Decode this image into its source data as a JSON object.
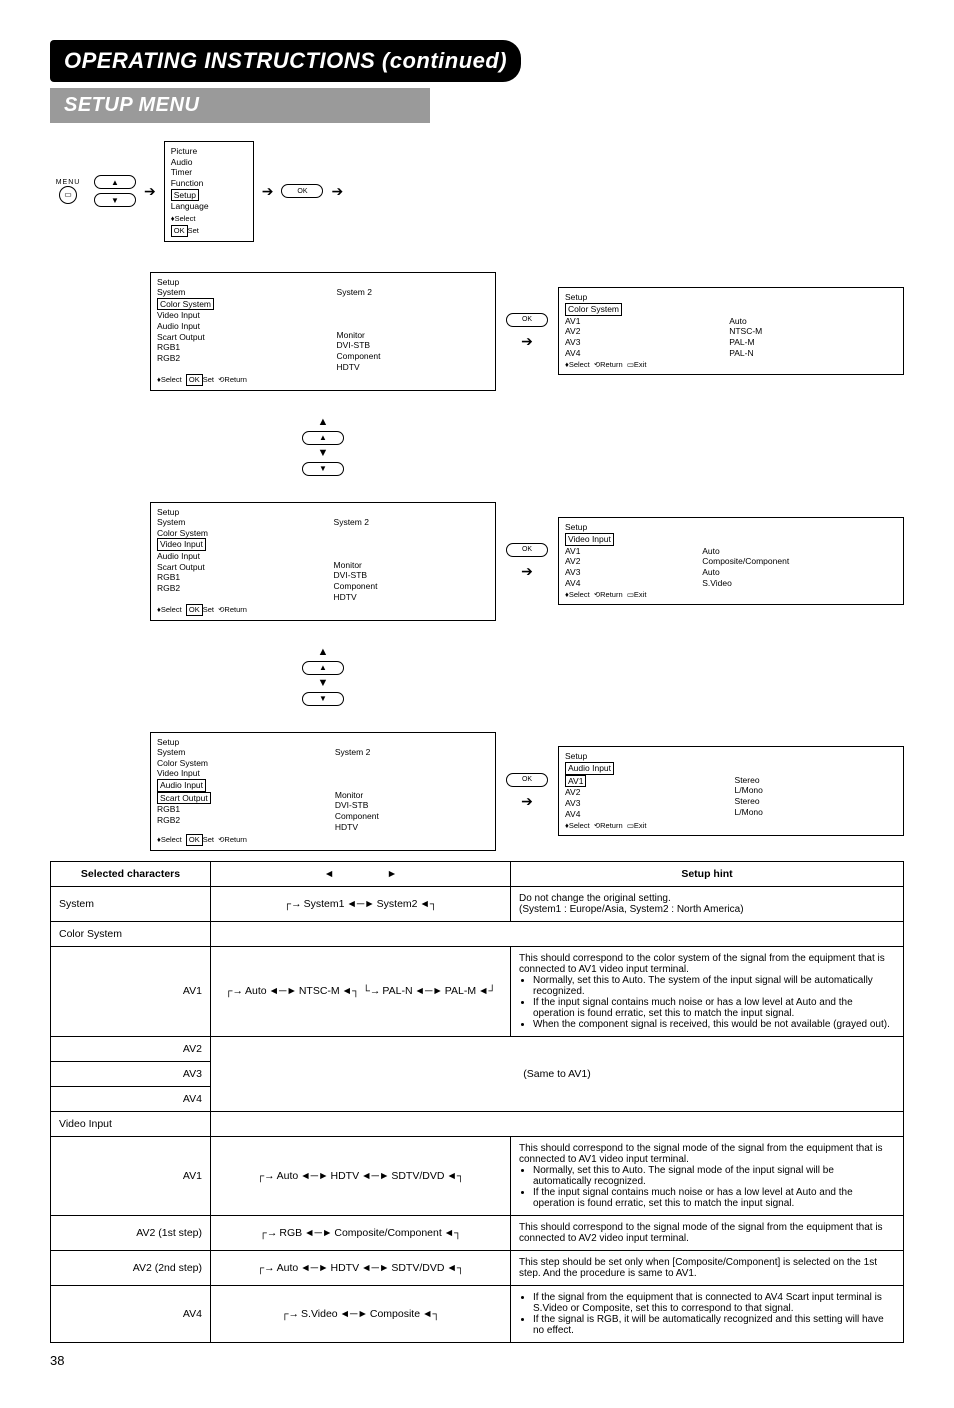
{
  "page_number": "38",
  "titles": {
    "main": "OPERATING INSTRUCTIONS (continued)",
    "sub": "SETUP MENU"
  },
  "menu_btn": {
    "label": "MENU"
  },
  "ok_btn": {
    "label": "OK"
  },
  "osd_main_menu": {
    "items": [
      "Picture",
      "Audio",
      "Timer",
      "Function",
      "Setup",
      "Language"
    ],
    "highlight": "Setup",
    "footer_select": "Select",
    "footer_set": "Set",
    "footer_ok": "OK"
  },
  "osd_setup_list": {
    "title": "Setup",
    "items": [
      "System",
      "Color System",
      "Video Input",
      "Audio Input",
      "Scart Output",
      "RGB1",
      "RGB2"
    ],
    "right_col_header": "System 2",
    "right_values": [
      "Monitor",
      "DVI-STB",
      "Component",
      "HDTV"
    ],
    "footer": {
      "select": "Select",
      "set": "Set",
      "ok": "OK",
      "return": "Return"
    }
  },
  "osd_color_system": {
    "title": "Setup",
    "hl": "Color System",
    "rows": [
      {
        "k": "AV1",
        "v": "Auto"
      },
      {
        "k": "AV2",
        "v": "NTSC-M"
      },
      {
        "k": "AV3",
        "v": "PAL-M"
      },
      {
        "k": "AV4",
        "v": "PAL-N"
      }
    ],
    "footer": {
      "select": "Select",
      "return": "Return",
      "exit": "Exit"
    }
  },
  "osd_video_input": {
    "title": "Setup",
    "hl": "Video Input",
    "rows": [
      {
        "k": "AV1",
        "v": "Auto"
      },
      {
        "k": "AV2",
        "v": "Composite/Component"
      },
      {
        "k": "AV3",
        "v": "Auto"
      },
      {
        "k": "AV4",
        "v": "S.Video"
      }
    ],
    "footer": {
      "select": "Select",
      "return": "Return",
      "exit": "Exit"
    }
  },
  "osd_audio_input": {
    "title": "Setup",
    "hl": "Audio Input",
    "rows": [
      {
        "k": "AV1",
        "v": "Stereo"
      },
      {
        "k": "AV2",
        "v": "L/Mono"
      },
      {
        "k": "AV3",
        "v": "Stereo"
      },
      {
        "k": "AV4",
        "v": "L/Mono"
      }
    ],
    "footer": {
      "select": "Select",
      "return": "Return",
      "exit": "Exit"
    }
  },
  "osd_setup_highlights": {
    "color_system": "Color System",
    "video_input": "Video Input",
    "audio_input": "Audio Input",
    "scart_output": "Scart Output"
  },
  "table": {
    "headers": {
      "selected": "Selected characters",
      "left_arrow": "◄",
      "right_arrow": "►",
      "hint": "Setup hint"
    },
    "rows": {
      "system": {
        "label": "System",
        "cycle": [
          "System1",
          "System2"
        ],
        "hint_lines": [
          "Do not change the original setting.",
          "(System1 : Europe/Asia, System2 : North America)"
        ]
      },
      "color_system": {
        "label": "Color System"
      },
      "cs_av1": {
        "label": "AV1",
        "cycle_top": [
          "Auto",
          "NTSC-M"
        ],
        "cycle_bot": [
          "PAL-N",
          "PAL-M"
        ],
        "hints": [
          "This should correspond to the color system of the signal from the equipment that is connected to AV1 video input terminal.",
          "Normally, set this to Auto. The system of the input signal will be automatically recognized.",
          "If the input signal contains much noise or has a low level at Auto and the operation is found erratic, set this to match the input signal.",
          "When the component signal is received, this would be not available (grayed out)."
        ]
      },
      "cs_av2": {
        "label": "AV2"
      },
      "cs_av3": {
        "label": "AV3",
        "same": "(Same to AV1)"
      },
      "cs_av4": {
        "label": "AV4"
      },
      "video_input": {
        "label": "Video Input"
      },
      "vi_av1": {
        "label": "AV1",
        "cycle": [
          "Auto",
          "HDTV",
          "SDTV/DVD"
        ],
        "hints": [
          "This should correspond to the signal mode of the signal from the equipment that is connected to AV1 video input terminal.",
          "Normally, set this to Auto. The signal mode of the input signal will be automatically recognized.",
          "If the input signal contains much noise or has a low level at Auto and the operation is found erratic, set this to match the input signal."
        ]
      },
      "vi_av2_1": {
        "label": "AV2 (1st step)",
        "cycle": [
          "RGB",
          "Composite/Component"
        ],
        "hint": "This should correspond to the signal mode of the signal from the equipment that is connected to AV2 video input terminal."
      },
      "vi_av2_2": {
        "label": "AV2 (2nd step)",
        "cycle": [
          "Auto",
          "HDTV",
          "SDTV/DVD"
        ],
        "hint": "This step should be set only when [Composite/Component] is selected on the 1st step. And the procedure is same to AV1."
      },
      "vi_av4": {
        "label": "AV4",
        "cycle": [
          "S.Video",
          "Composite"
        ],
        "hints": [
          "If the signal from the equipment that is connected to AV4 Scart input terminal is S.Video or Composite, set this to correspond to that signal.",
          "If the signal is RGB, it will be automatically recognized and this setting will have no effect."
        ]
      }
    }
  }
}
